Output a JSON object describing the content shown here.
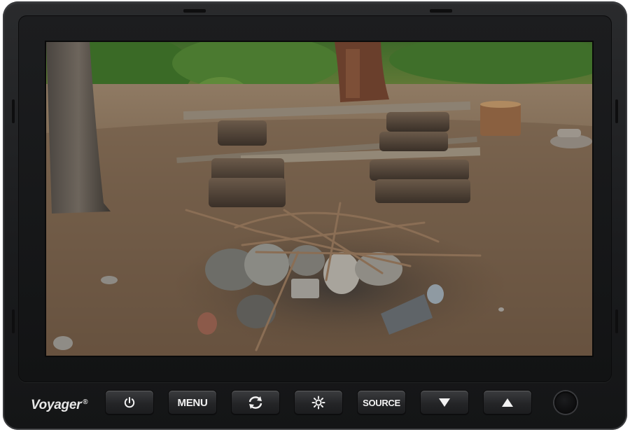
{
  "device": {
    "brand": "Voyager",
    "brand_mark": "®"
  },
  "controls": {
    "buttons": [
      {
        "id": "power",
        "icon": "power-icon"
      },
      {
        "id": "menu",
        "label": "MENU"
      },
      {
        "id": "rotate",
        "icon": "rotate-arrows-icon"
      },
      {
        "id": "brightness",
        "icon": "sun-icon"
      },
      {
        "id": "source",
        "label": "SOURCE"
      },
      {
        "id": "down",
        "icon": "triangle-down-icon"
      },
      {
        "id": "up",
        "icon": "triangle-up-icon"
      }
    ],
    "sensor": "ambient-light-sensor"
  },
  "colors": {
    "housing": "#1a1b1d",
    "button": "#2a2b2d",
    "button_text": "#f2f2f2",
    "logo": "#e7e7e7"
  }
}
